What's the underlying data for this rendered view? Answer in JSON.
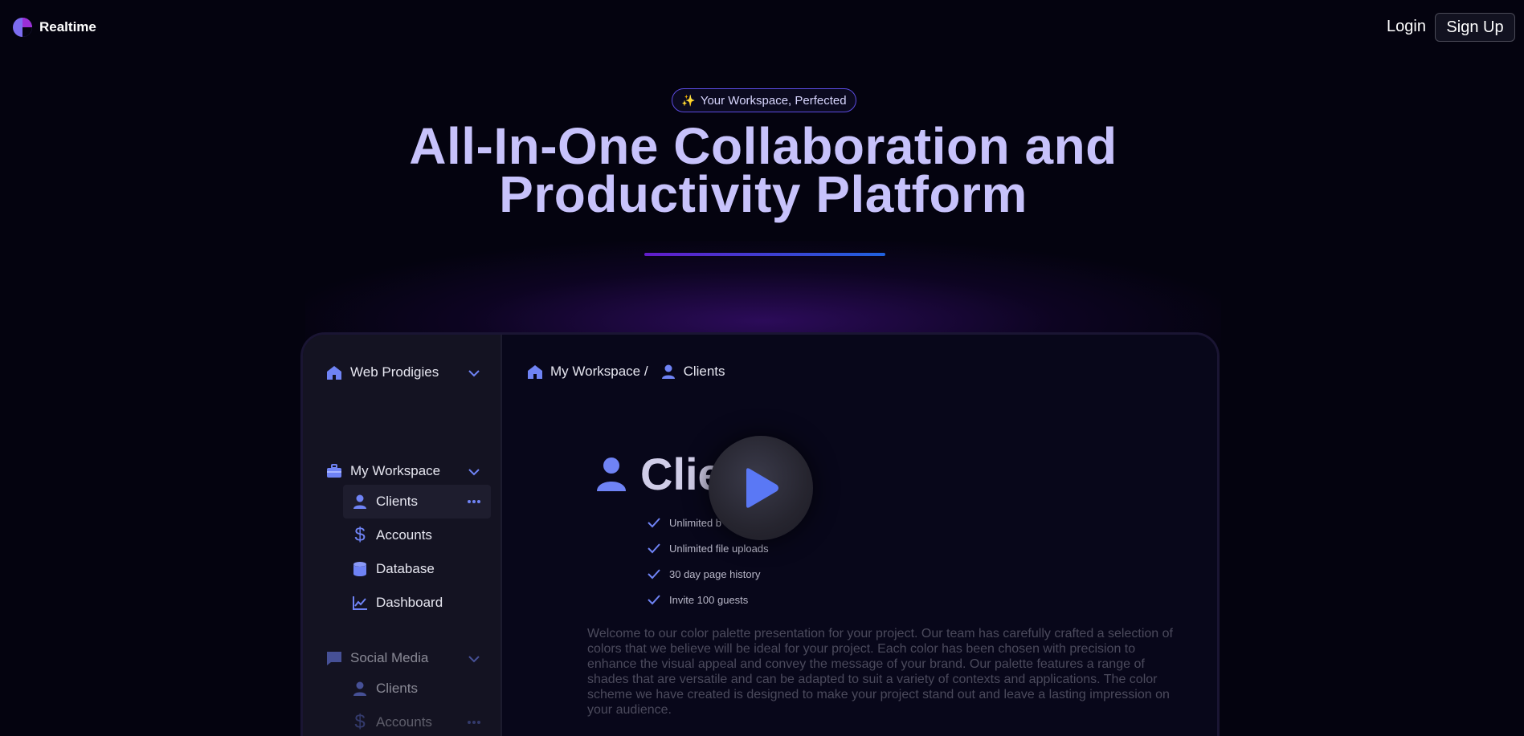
{
  "app": {
    "name": "Realtime"
  },
  "nav": {
    "login_label": "Login",
    "signup_label": "Sign Up"
  },
  "hero": {
    "badge_icon": "sparkles-icon",
    "badge_icon_glyph": "✨",
    "badge_text": "Your Workspace, Perfected",
    "title_line1": "All-In-One Collaboration and",
    "title_line2": "Productivity Platform"
  },
  "sidebar": {
    "workspace_name": "Web Prodigies",
    "sections": [
      {
        "label": "My Workspace",
        "items": [
          {
            "label": "Clients",
            "icon": "user-icon",
            "active": true
          },
          {
            "label": "Accounts",
            "icon": "dollar-icon"
          },
          {
            "label": "Database",
            "icon": "database-icon"
          },
          {
            "label": "Dashboard",
            "icon": "chart-line-icon"
          }
        ]
      },
      {
        "label": "Social Media",
        "items": [
          {
            "label": "Clients",
            "icon": "user-icon"
          },
          {
            "label": "Accounts",
            "icon": "dollar-icon"
          }
        ]
      }
    ]
  },
  "breadcrumb": {
    "workspace": "My Workspace /",
    "page": "Clients"
  },
  "page": {
    "heading": "Clie",
    "features": [
      "Unlimited b",
      "Unlimited file uploads",
      "30 day page history",
      "Invite 100 guests"
    ],
    "description": "Welcome to our color palette presentation for your project. Our team has carefully crafted a selection of colors that we believe will be ideal for your project. Each color has been chosen with precision to enhance the visual appeal and convey the message of your brand. Our palette features a range of shades that are versatile and can be adapted to suit a variety of contexts and applications. The color scheme we have created is designed to make your project stand out and leave a lasting impression on your audience."
  },
  "colors": {
    "background": "#04030f",
    "hero_text": "#c7c2fb",
    "accent_purple": "#6a1fd9",
    "accent_blue": "#1f6ef0",
    "icon_blue": "#6f83f5"
  }
}
